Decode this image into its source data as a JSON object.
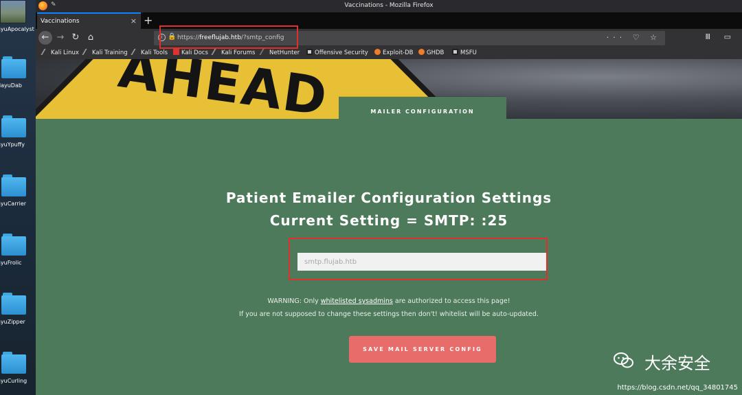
{
  "desktop": {
    "icons": [
      {
        "label": "ayuApocalyst"
      },
      {
        "label": "dayuDab"
      },
      {
        "label": "ayuYpuffy"
      },
      {
        "label": "ayuCarrier"
      },
      {
        "label": "ayuFrolic"
      },
      {
        "label": "ayuZipper"
      },
      {
        "label": "ayuCurling"
      }
    ]
  },
  "window": {
    "title": "Vaccinations - Mozilla Firefox"
  },
  "tabs": [
    {
      "label": "Vaccinations",
      "close": "×"
    }
  ],
  "newtab": "+",
  "nav": {
    "back": "←",
    "forward": "→",
    "reload": "↻",
    "home": "⌂"
  },
  "url": {
    "scheme": "https://",
    "host": "freeflujab.htb",
    "path": "/?smtp_config",
    "actions": "··· ♡ ☆"
  },
  "toolbar_right": "Ⅲ ▭",
  "bookmarks": [
    {
      "label": "Kali Linux"
    },
    {
      "label": "Kali Training"
    },
    {
      "label": "Kali Tools"
    },
    {
      "label": "Kali Docs"
    },
    {
      "label": "Kali Forums"
    },
    {
      "label": "NetHunter"
    },
    {
      "label": "Offensive Security"
    },
    {
      "label": "Exploit-DB"
    },
    {
      "label": "GHDB"
    },
    {
      "label": "MSFU"
    }
  ],
  "hero": {
    "sign_text": "AHEAD"
  },
  "page": {
    "section_tab": "MAILER CONFIGURATION",
    "heading1": "Patient Emailer Configuration Settings",
    "heading2": "Current Setting = SMTP: :25",
    "input_placeholder": "smtp.flujab.htb",
    "warning_prefix": "WARNING: Only ",
    "warning_link": "whitelisted sysadmins",
    "warning_suffix": " are authorized to access this page!",
    "warning_line2": "If you are not supposed to change these settings then don't! whitelist will be auto-updated.",
    "save_button": "SAVE MAIL SERVER CONFIG"
  },
  "watermark": {
    "text": "大余安全",
    "url": "https://blog.csdn.net/qq_34801745"
  },
  "colors": {
    "page_green": "#4e7a5c",
    "button": "#e86c6a",
    "highlight": "#e0302c"
  }
}
